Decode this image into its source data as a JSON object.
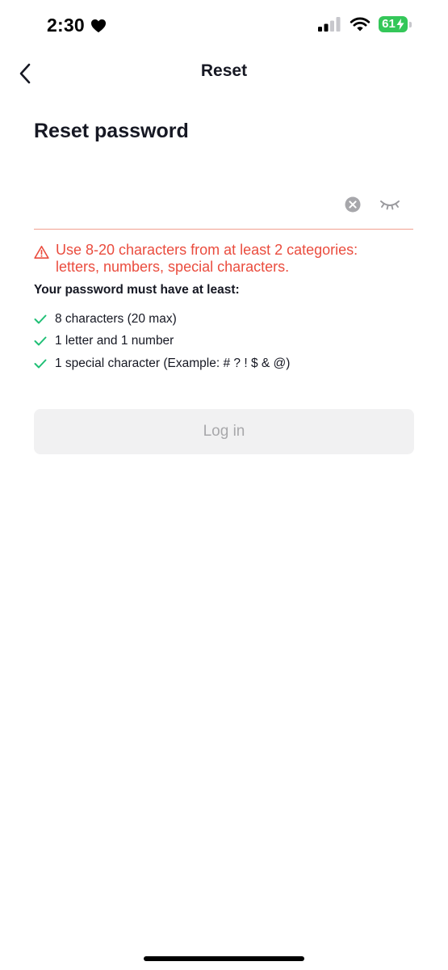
{
  "status_bar": {
    "time": "2:30",
    "battery_level": "61",
    "icons": [
      "heart-icon",
      "signal-icon",
      "wifi-icon",
      "battery-icon",
      "bolt-icon"
    ],
    "battery_color": "#34c759"
  },
  "nav": {
    "title": "Reset",
    "back_icon": "chevron-left-icon"
  },
  "page": {
    "title": "Reset password"
  },
  "password_field": {
    "value": "",
    "placeholder": "",
    "clear_icon": "clear-icon",
    "visibility_icon": "eye-closed-icon",
    "underline_color": "#f2a08f"
  },
  "error": {
    "icon": "warning-icon",
    "line1": "Use 8-20 characters from at least 2 categories:",
    "line2": "letters, numbers, special characters.",
    "color": "#ea4c3e"
  },
  "rules": {
    "title": "Your password must have at least:",
    "check_color": "#1fbf75",
    "items": [
      {
        "label": "8 characters (20 max)",
        "met": true
      },
      {
        "label": "1 letter and 1 number",
        "met": true
      },
      {
        "label": "1 special character (Example: # ? ! $ & @)",
        "met": true
      }
    ]
  },
  "login_button": {
    "label": "Log in",
    "enabled": false
  }
}
